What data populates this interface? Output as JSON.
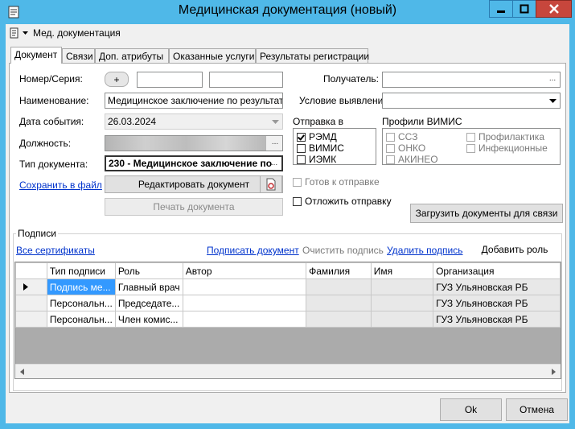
{
  "window": {
    "title": "Медицинская документация (новый)"
  },
  "toolbar": {
    "menu_label": "Мед. документация"
  },
  "tabs": [
    {
      "label": "Документ"
    },
    {
      "label": "Связи"
    },
    {
      "label": "Доп. атрибуты"
    },
    {
      "label": "Оказанные услуги"
    },
    {
      "label": "Результаты регистрации"
    }
  ],
  "form": {
    "number_label": "Номер/Серия:",
    "plus_label": "+",
    "number_value": "",
    "series_value": "",
    "name_label": "Наименование:",
    "name_value": "Медицинское заключение по результатам",
    "date_label": "Дата события:",
    "date_value": "26.03.2024",
    "position_label": "Должность:",
    "doc_type_label": "Тип документа:",
    "doc_type_value": "230 - Медицинское заключение по",
    "ellipsis": "...",
    "recipient_label": "Получатель:",
    "recipient_value": "",
    "condition_label": "Условие выявления:",
    "condition_value": "",
    "send_to_label": "Отправка в",
    "vimis_profiles_label": "Профили ВИМИС",
    "send_to": [
      {
        "label": "РЭМД",
        "checked": true
      },
      {
        "label": "ВИМИС",
        "checked": false
      },
      {
        "label": "ИЭМК",
        "checked": false
      }
    ],
    "profiles_col1": [
      {
        "label": "ССЗ"
      },
      {
        "label": "ОНКО"
      },
      {
        "label": "АКИНЕО"
      }
    ],
    "profiles_col2": [
      {
        "label": "Профилактика"
      },
      {
        "label": "Инфекционные"
      }
    ],
    "ready_label": "Готов к отправке",
    "postpone_label": "Отложить отправку",
    "save_link": "Сохранить в файл",
    "edit_button": "Редактировать документ",
    "print_button": "Печать документа",
    "load_button": "Загрузить документы для связи"
  },
  "signatures": {
    "group_label": "Подписи",
    "all_certs": "Все сертификаты",
    "sign_doc": "Подписать документ",
    "clear_sign": "Очистить подпись",
    "delete_sign": "Удалить подпись",
    "add_role": "Добавить роль",
    "columns": [
      "Тип подписи",
      "Роль",
      "Автор",
      "Фамилия",
      "Имя",
      "Организация"
    ],
    "rows": [
      {
        "type": "Подпись ме...",
        "role": "Главный врач",
        "author": "",
        "surname": "",
        "name": "",
        "org": "ГУЗ Ульяновская РБ"
      },
      {
        "type": "Персональн...",
        "role": "Председате...",
        "author": "",
        "surname": "",
        "name": "",
        "org": "ГУЗ Ульяновская РБ"
      },
      {
        "type": "Персональн...",
        "role": "Член комис...",
        "author": "",
        "surname": "",
        "name": "",
        "org": "ГУЗ Ульяновская РБ"
      }
    ]
  },
  "footer": {
    "ok": "Ok",
    "cancel": "Отмена"
  }
}
